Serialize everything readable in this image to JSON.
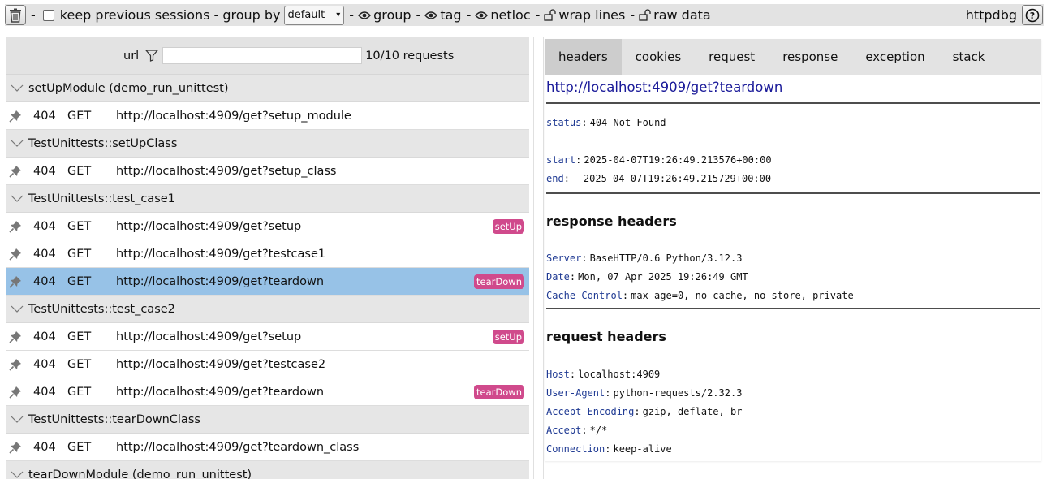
{
  "toolbar": {
    "clear_icon": "trash-icon",
    "sep1": "-",
    "keep_label": "keep previous sessions",
    "sep2": "- group by",
    "group_by_value": "default",
    "sep3": "-",
    "group_label": "group",
    "sep4": "-",
    "tag_label": "tag",
    "sep5": "-",
    "netloc_label": "netloc",
    "sep6": "-",
    "wrap_label": "wrap lines",
    "sep7": "-",
    "raw_label": "raw data",
    "brand": "httpdbg",
    "help_icon": "help-icon"
  },
  "filter": {
    "label": "url",
    "placeholder": "",
    "count": "10/10 requests"
  },
  "requests": {
    "groups": [
      {
        "title": "setUpModule (demo_run_unittest)",
        "rows": [
          {
            "status": "404",
            "method": "GET",
            "url": "http://localhost:4909/get?setup_module",
            "tag": ""
          }
        ]
      },
      {
        "title": "TestUnittests::setUpClass",
        "rows": [
          {
            "status": "404",
            "method": "GET",
            "url": "http://localhost:4909/get?setup_class",
            "tag": ""
          }
        ]
      },
      {
        "title": "TestUnittests::test_case1",
        "rows": [
          {
            "status": "404",
            "method": "GET",
            "url": "http://localhost:4909/get?setup",
            "tag": "setUp"
          },
          {
            "status": "404",
            "method": "GET",
            "url": "http://localhost:4909/get?testcase1",
            "tag": ""
          },
          {
            "status": "404",
            "method": "GET",
            "url": "http://localhost:4909/get?teardown",
            "tag": "tearDown"
          }
        ]
      },
      {
        "title": "TestUnittests::test_case2",
        "rows": [
          {
            "status": "404",
            "method": "GET",
            "url": "http://localhost:4909/get?setup",
            "tag": "setUp"
          },
          {
            "status": "404",
            "method": "GET",
            "url": "http://localhost:4909/get?testcase2",
            "tag": ""
          },
          {
            "status": "404",
            "method": "GET",
            "url": "http://localhost:4909/get?teardown",
            "tag": "tearDown"
          }
        ]
      },
      {
        "title": "TestUnittests::tearDownClass",
        "rows": [
          {
            "status": "404",
            "method": "GET",
            "url": "http://localhost:4909/get?teardown_class",
            "tag": ""
          }
        ]
      },
      {
        "title": "tearDownModule (demo_run_unittest)",
        "rows": []
      }
    ],
    "selected": "g2r2"
  },
  "tabs": [
    {
      "label": "headers",
      "active": true
    },
    {
      "label": "cookies",
      "active": false
    },
    {
      "label": "request",
      "active": false
    },
    {
      "label": "response",
      "active": false
    },
    {
      "label": "exception",
      "active": false
    },
    {
      "label": "stack",
      "active": false
    }
  ],
  "detail": {
    "url": "http://localhost:4909/get?teardown",
    "status_key": "status",
    "status_value": "404 Not Found",
    "start_key": "start",
    "start_value": "2025-04-07T19:26:49.213576+00:00",
    "end_key": "end",
    "end_value": "2025-04-07T19:26:49.215729+00:00",
    "response_headers_title": "response headers",
    "response_headers": [
      {
        "k": "Server",
        "v": "BaseHTTP/0.6 Python/3.12.3"
      },
      {
        "k": "Date",
        "v": "Mon, 07 Apr 2025 19:26:49 GMT"
      },
      {
        "k": "Cache-Control",
        "v": "max-age=0, no-cache, no-store, private"
      }
    ],
    "request_headers_title": "request headers",
    "request_headers": [
      {
        "k": "Host",
        "v": "localhost:4909"
      },
      {
        "k": "User-Agent",
        "v": "python-requests/2.32.3"
      },
      {
        "k": "Accept-Encoding",
        "v": "gzip, deflate, br"
      },
      {
        "k": "Accept",
        "v": "*/*"
      },
      {
        "k": "Connection",
        "v": "keep-alive"
      }
    ]
  },
  "colors": {
    "toolbar_bg": "#e3e3e3",
    "selected_row": "#97c2e7",
    "tag_bg": "#d04a8c",
    "header_key": "#1f3a93"
  }
}
